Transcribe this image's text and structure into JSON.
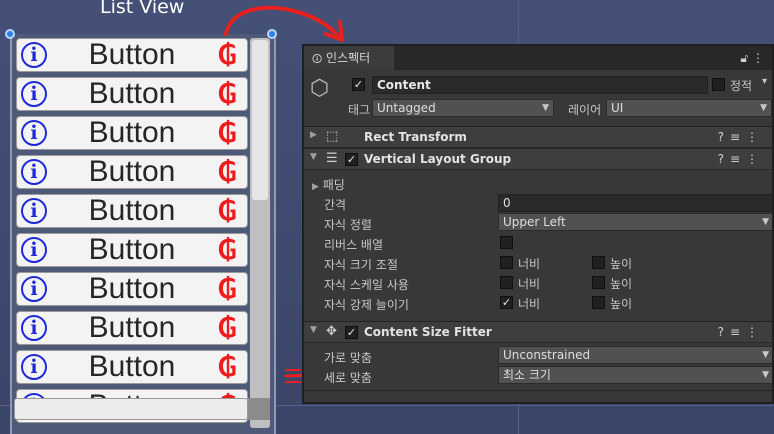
{
  "scene": {
    "title": "List View",
    "button_rows": [
      {
        "info_icon": "info-icon",
        "label": "Button",
        "logo_glyph": "₲"
      },
      {
        "info_icon": "info-icon",
        "label": "Button",
        "logo_glyph": "₲"
      },
      {
        "info_icon": "info-icon",
        "label": "Button",
        "logo_glyph": "₲"
      },
      {
        "info_icon": "info-icon",
        "label": "Button",
        "logo_glyph": "₲"
      },
      {
        "info_icon": "info-icon",
        "label": "Button",
        "logo_glyph": "₲"
      },
      {
        "info_icon": "info-icon",
        "label": "Button",
        "logo_glyph": "₲"
      },
      {
        "info_icon": "info-icon",
        "label": "Button",
        "logo_glyph": "₲"
      },
      {
        "info_icon": "info-icon",
        "label": "Button",
        "logo_glyph": "₲"
      },
      {
        "info_icon": "info-icon",
        "label": "Button",
        "logo_glyph": "₲"
      },
      {
        "info_icon": "info-icon",
        "label": "Button",
        "logo_glyph": "₲"
      }
    ],
    "info_glyph": "i",
    "colors": {
      "info_blue": "#1e2ad8",
      "logo_red": "#ee1c1c",
      "annotation_red": "#e8201e"
    }
  },
  "inspector": {
    "tab_label": "인스펙터",
    "tab_icon": "info-circle-icon",
    "header_icons": [
      "lock-icon",
      "kebab-menu-icon"
    ],
    "object": {
      "icon": "cube-icon",
      "enabled": true,
      "name": "Content",
      "static_label": "정적",
      "static_checked": false,
      "tag_label": "태그",
      "tag_value": "Untagged",
      "layer_label": "레이어",
      "layer_value": "UI"
    },
    "components": {
      "rect_transform": {
        "title": "Rect Transform",
        "icon": "rect-transform-icon",
        "expanded": false
      },
      "vertical_layout_group": {
        "title": "Vertical Layout Group",
        "icon": "layout-group-icon",
        "enabled": true,
        "expanded": true,
        "padding_label": "패딩",
        "spacing_label": "간격",
        "spacing_value": "0",
        "child_alignment_label": "자식 정렬",
        "child_alignment_value": "Upper Left",
        "reverse_arrangement_label": "리버스 배열",
        "reverse_arrangement_checked": false,
        "control_child_size_label": "자식 크기 조절",
        "use_child_scale_label": "자식 스케일 사용",
        "child_force_expand_label": "자식 강제 늘이기",
        "width_label": "너비",
        "height_label": "높이",
        "control_child_size": {
          "width": false,
          "height": false
        },
        "use_child_scale": {
          "width": false,
          "height": false
        },
        "child_force_expand": {
          "width": true,
          "height": false
        }
      },
      "content_size_fitter": {
        "title": "Content Size Fitter",
        "icon": "content-size-fitter-icon",
        "enabled": true,
        "expanded": true,
        "horizontal_fit_label": "가로 맞춤",
        "horizontal_fit_value": "Unconstrained",
        "vertical_fit_label": "세로 맞춤",
        "vertical_fit_value": "최소 크기"
      }
    },
    "tool_icons": [
      "help-icon",
      "presets-icon",
      "kebab-menu-icon"
    ]
  }
}
